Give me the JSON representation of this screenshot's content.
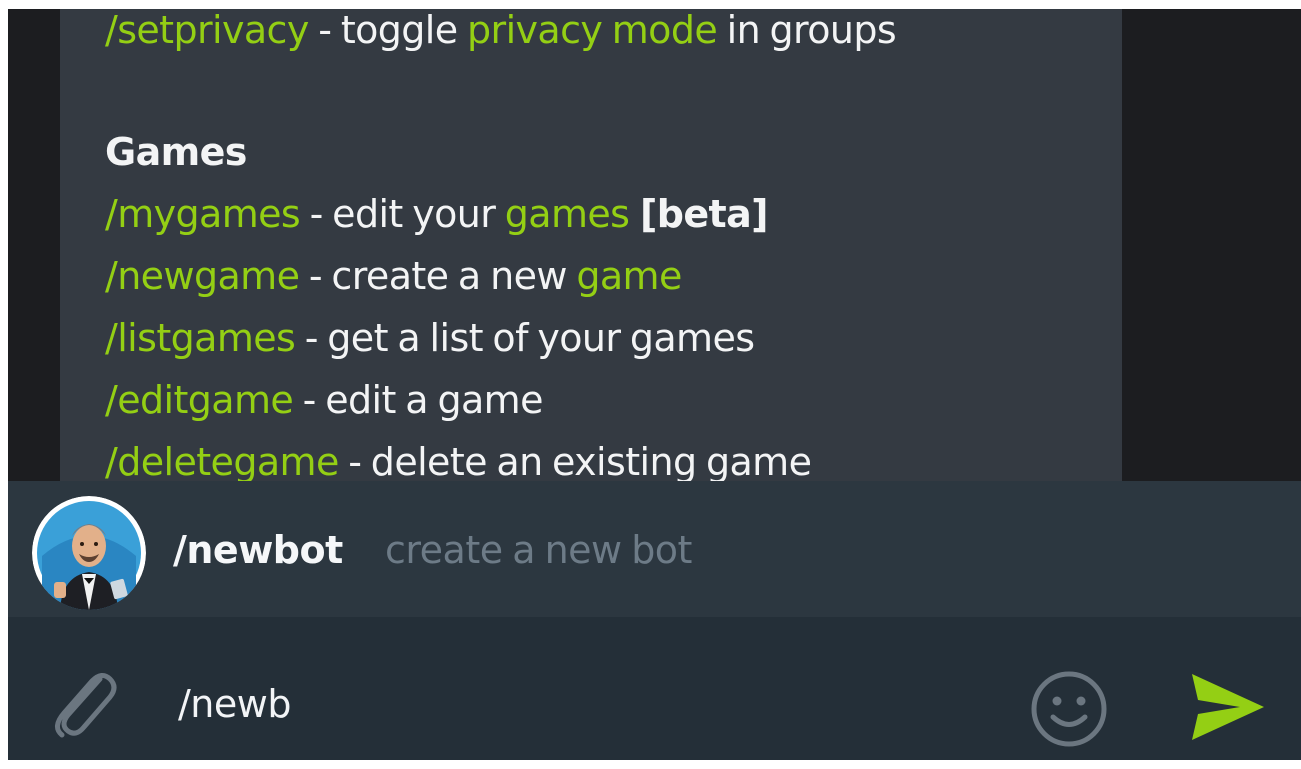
{
  "chat": {
    "messages": [
      {
        "kind": "cmd",
        "command": "/setprivacy",
        "text_before": " - toggle ",
        "highlight": "privacy mode",
        "text_after": " in groups"
      },
      {
        "kind": "heading",
        "text": "Games"
      },
      {
        "kind": "cmd",
        "command": "/mygames",
        "text_before": " - edit your ",
        "highlight": "games",
        "bold_suffix": " [beta]"
      },
      {
        "kind": "cmd",
        "command": "/newgame",
        "text_before": " - create a new ",
        "highlight": "game"
      },
      {
        "kind": "cmd",
        "command": "/listgames",
        "text_before": " - get a list of your games"
      },
      {
        "kind": "cmd",
        "command": "/editgame",
        "text_before": " - edit a game"
      },
      {
        "kind": "cmd",
        "command": "/deletegame",
        "text_before": " - delete an existing game"
      }
    ]
  },
  "suggestion": {
    "command": "/newbot",
    "description": "create a new bot",
    "avatar_icon": "botfather-avatar"
  },
  "input": {
    "value": "/newb",
    "attach_icon": "paperclip-icon",
    "emoji_icon": "smiley-icon",
    "send_icon": "send-arrow-icon"
  },
  "colors": {
    "accent": "#94cf14",
    "chat_background": "#1c1d20",
    "bubble_background": "#343a42",
    "suggestion_background": "#2c3740",
    "input_background": "#242f38",
    "muted_text": "#6d7b87"
  }
}
